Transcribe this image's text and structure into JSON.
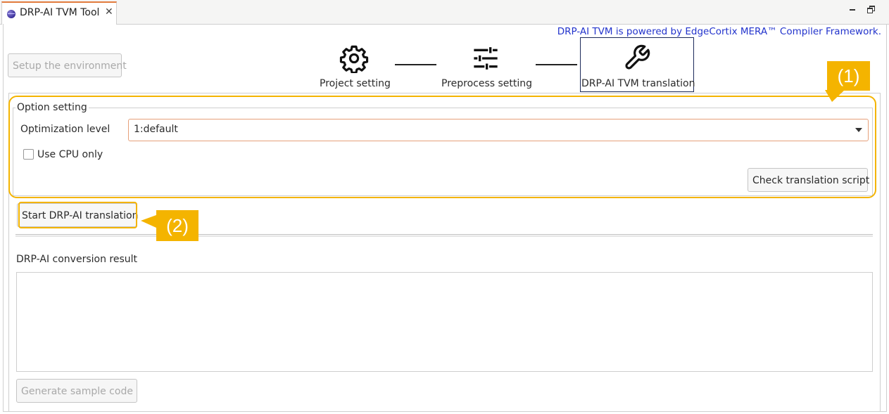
{
  "tab": {
    "title": "DRP-AI TVM Tool",
    "close_glyph": "✕",
    "icon": "eclipse-icon"
  },
  "window_controls": {
    "minimize_icon": "minimize-icon",
    "restore_icon": "restore-icon"
  },
  "powered_by": "DRP-AI TVM is powered by EdgeCortix MERA™ Compiler Framework.",
  "setup_button": "Setup the environment",
  "steps": [
    {
      "label": "Project setting",
      "icon": "gear-icon",
      "active": false
    },
    {
      "label": "Preprocess setting",
      "icon": "sliders-icon",
      "active": false
    },
    {
      "label": "DRP-AI TVM translation",
      "icon": "wrench-icon",
      "active": true
    }
  ],
  "option_setting": {
    "title": "Option setting",
    "optimization_label": "Optimization level",
    "optimization_value": "1:default",
    "use_cpu_label": "Use CPU only",
    "use_cpu_checked": false,
    "check_script_button": "Check translation script"
  },
  "start_button": "Start DRP-AI translation",
  "result": {
    "label": "DRP-AI conversion result",
    "text": ""
  },
  "generate_button": "Generate sample code",
  "annotations": {
    "callout1": "(1)",
    "callout2": "(2)"
  },
  "colors": {
    "accent_highlight": "#f4b400",
    "link_blue": "#2233cc",
    "active_step_border": "#1c2a5a"
  }
}
